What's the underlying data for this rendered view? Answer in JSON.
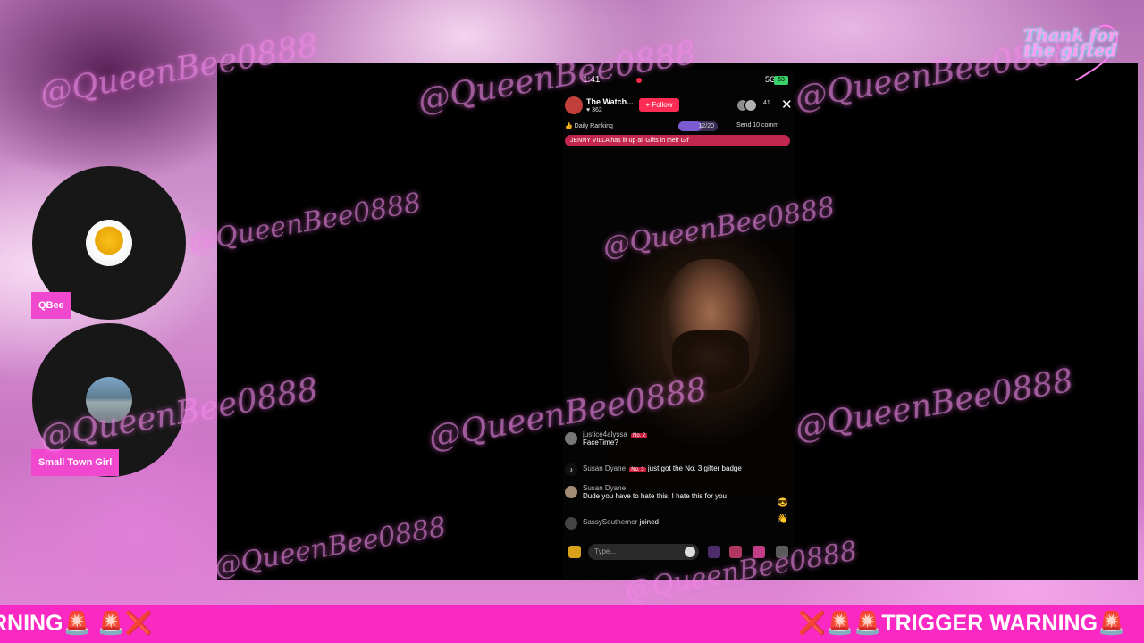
{
  "stream_overlay": {
    "watermark": "@QueenBee0888",
    "logo_text": "Thank for the gifted",
    "ticker_left": "RNING🚨 🚨❌",
    "ticker_right": "❌🚨🚨TRIGGER WARNING🚨",
    "accent_color": "#fb29c3"
  },
  "participants": [
    {
      "name": "QBee"
    },
    {
      "name": "Small Town Girl"
    }
  ],
  "phone": {
    "status": {
      "time": "1:41",
      "network": "5G",
      "battery": "63"
    },
    "host": {
      "name": "The Watch...",
      "likes": "362",
      "follow_label": "+ Follow",
      "viewer_count": "41"
    },
    "ranking": {
      "label": "Daily Ranking",
      "progress": "12/20",
      "progress_fraction": 0.6,
      "send_label": "Send 10 comm"
    },
    "gift_banner": "JENNY  VILLA has lit up all Gifts in their Gif",
    "chat": [
      {
        "user": "justice4alyssa",
        "badge": "No. 2",
        "text": "FaceTime?"
      },
      {
        "user": "Susan Dyane",
        "badge": "No. 3",
        "text": "just got the No. 3 gifter badge"
      },
      {
        "user": "Susan Dyane",
        "badge": "",
        "text": "Dude you have to hate this. I hate this for you",
        "emoji": "😎"
      },
      {
        "user": "SassySoutherner",
        "badge": "",
        "text": "joined"
      }
    ],
    "input_placeholder": "Type..."
  }
}
